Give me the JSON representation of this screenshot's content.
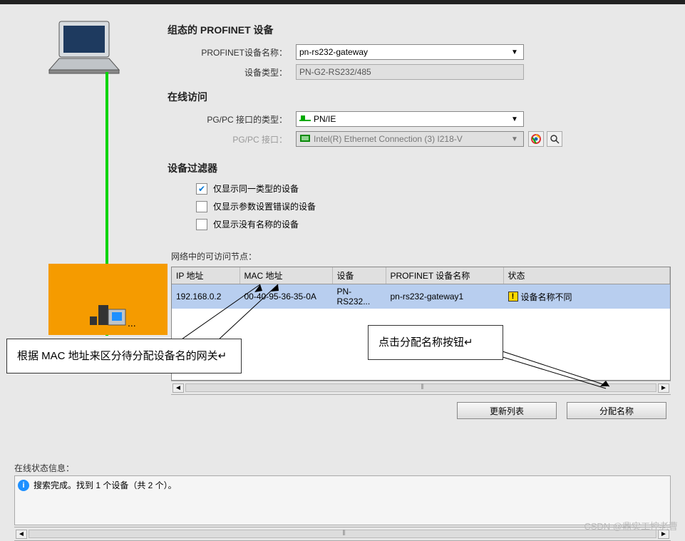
{
  "section_profinet_title": "组态的 PROFINET 设备",
  "label_device_name": "PROFINET设备名称：",
  "device_name_value": "pn-rs232-gateway",
  "label_device_type": "设备类型：",
  "device_type_value": "PN-G2-RS232/485",
  "section_online_title": "在线访问",
  "label_pgpc_type": "PG/PC 接口的类型：",
  "pgpc_type_value": "PN/IE",
  "label_pgpc_iface": "PG/PC 接口：",
  "pgpc_iface_value": "Intel(R) Ethernet Connection (3) I218-V",
  "section_filter_title": "设备过滤器",
  "filter_same_type": "仅显示同一类型的设备",
  "filter_param_error": "仅显示参数设置错误的设备",
  "filter_no_name": "仅显示没有名称的设备",
  "nodes_label": "网络中的可访问节点：",
  "columns": {
    "ip": "IP 地址",
    "mac": "MAC 地址",
    "device": "设备",
    "pn_name": "PROFINET 设备名称",
    "status": "状态"
  },
  "row1": {
    "ip": "192.168.0.2",
    "mac": "00-40-95-36-35-0A",
    "device": "PN-RS232...",
    "pn_name": "pn-rs232-gateway1",
    "status": "设备名称不同"
  },
  "btn_refresh": "更新列表",
  "btn_assign": "分配名称",
  "status_section_label": "在线状态信息：",
  "status_msg": "搜索完成。找到 1 个设备（共 2 个）。",
  "callout1_text": "根据 MAC 地址来区分待分配设备名的网关↵",
  "callout2_text": "点击分配名称按钮↵",
  "watermark": "CSDN @鼎实工控老曹"
}
